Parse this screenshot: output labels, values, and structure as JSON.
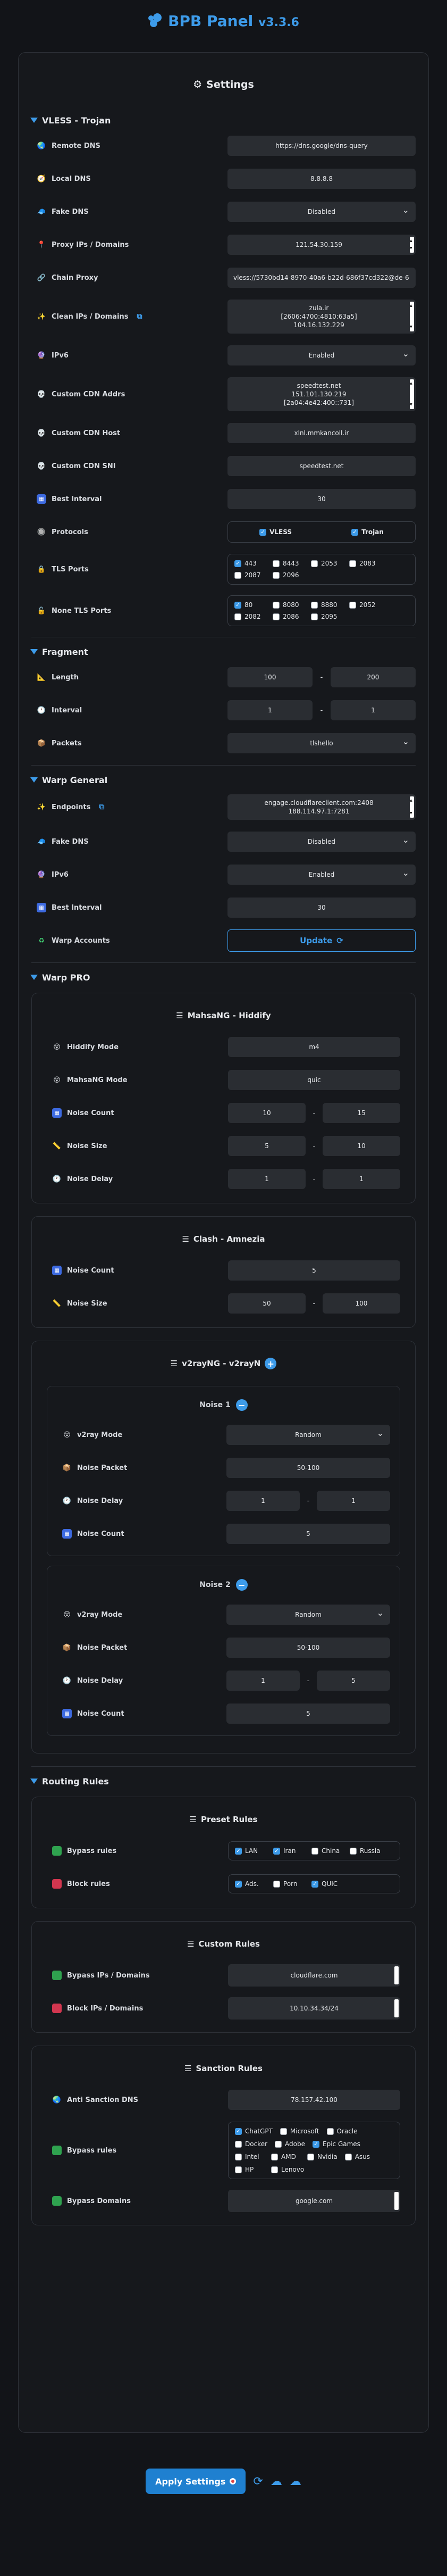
{
  "header": {
    "title": "BPB Panel",
    "version": "v3.3.6"
  },
  "settings": {
    "title": "Settings"
  },
  "vless": {
    "section": "VLESS - Trojan",
    "remote_dns": {
      "label": "Remote DNS",
      "value": "https://dns.google/dns-query"
    },
    "local_dns": {
      "label": "Local DNS",
      "value": "8.8.8.8"
    },
    "fake_dns": {
      "label": "Fake DNS",
      "value": "Disabled"
    },
    "proxy_ips": {
      "label": "Proxy IPs / Domains",
      "value": "121.54.30.159"
    },
    "chain_proxy": {
      "label": "Chain Proxy",
      "value": "vless://5730bd14-8970-40a6-b22d-686f37cd322@de-6"
    },
    "clean_ips": {
      "label": "Clean IPs / Domains",
      "lines": [
        "zula.ir",
        "[2606:4700:4810:63a5]",
        "104.16.132.229"
      ]
    },
    "ipv6": {
      "label": "IPv6",
      "value": "Enabled"
    },
    "cdn_addrs": {
      "label": "Custom CDN Addrs",
      "lines": [
        "speedtest.net",
        "151.101.130.219",
        "[2a04:4e42:400::731]"
      ]
    },
    "cdn_host": {
      "label": "Custom CDN Host",
      "value": "xlnl.mmkancoll.ir"
    },
    "cdn_sni": {
      "label": "Custom CDN SNI",
      "value": "speedtest.net"
    },
    "best_interval": {
      "label": "Best Interval",
      "value": "30"
    },
    "protocols": {
      "label": "Protocols",
      "vless": "VLESS",
      "trojan": "Trojan"
    },
    "tls_ports": {
      "label": "TLS Ports",
      "ports": [
        "443",
        "8443",
        "2053",
        "2083",
        "2087",
        "2096"
      ],
      "checked": [
        true,
        false,
        false,
        false,
        false,
        false
      ]
    },
    "none_tls_ports": {
      "label": "None TLS Ports",
      "ports": [
        "80",
        "8080",
        "8880",
        "2052",
        "2082",
        "2086",
        "2095"
      ],
      "checked": [
        true,
        false,
        false,
        false,
        false,
        false,
        false
      ]
    }
  },
  "fragment": {
    "section": "Fragment",
    "length": {
      "label": "Length",
      "min": "100",
      "max": "200"
    },
    "interval": {
      "label": "Interval",
      "min": "1",
      "max": "1"
    },
    "packets": {
      "label": "Packets",
      "value": "tlshello"
    }
  },
  "warp": {
    "section": "Warp General",
    "endpoints": {
      "label": "Endpoints",
      "lines": [
        "engage.cloudflareclient.com:2408",
        "188.114.97.1:7281"
      ]
    },
    "fake_dns": {
      "label": "Fake DNS",
      "value": "Disabled"
    },
    "ipv6": {
      "label": "IPv6",
      "value": "Enabled"
    },
    "best_interval": {
      "label": "Best Interval",
      "value": "30"
    },
    "accounts": {
      "label": "Warp Accounts",
      "button": "Update"
    }
  },
  "warp_pro": {
    "section": "Warp PRO",
    "hiddify": {
      "title": "MahsaNG - Hiddify",
      "hiddify_mode": {
        "label": "Hiddify Mode",
        "value": "m4"
      },
      "mahsang_mode": {
        "label": "MahsaNG Mode",
        "value": "quic"
      },
      "noise_count": {
        "label": "Noise Count",
        "min": "10",
        "max": "15"
      },
      "noise_size": {
        "label": "Noise Size",
        "min": "5",
        "max": "10"
      },
      "noise_delay": {
        "label": "Noise Delay",
        "min": "1",
        "max": "1"
      }
    },
    "clash": {
      "title": "Clash - Amnezia",
      "noise_count": {
        "label": "Noise Count",
        "value": "5"
      },
      "noise_size": {
        "label": "Noise Size",
        "min": "50",
        "max": "100"
      }
    },
    "v2ray": {
      "title": "v2rayNG - v2rayN",
      "noise1": {
        "title": "Noise 1",
        "mode": {
          "label": "v2ray Mode",
          "value": "Random"
        },
        "packet": {
          "label": "Noise Packet",
          "value": "50-100"
        },
        "delay": {
          "label": "Noise Delay",
          "min": "1",
          "max": "1"
        },
        "count": {
          "label": "Noise Count",
          "value": "5"
        }
      },
      "noise2": {
        "title": "Noise 2",
        "mode": {
          "label": "v2ray Mode",
          "value": "Random"
        },
        "packet": {
          "label": "Noise Packet",
          "value": "50-100"
        },
        "delay": {
          "label": "Noise Delay",
          "min": "1",
          "max": "5"
        },
        "count": {
          "label": "Noise Count",
          "value": "5"
        }
      }
    }
  },
  "routing": {
    "section": "Routing Rules",
    "preset": {
      "title": "Preset Rules",
      "bypass": {
        "label": "Bypass rules",
        "items": [
          "LAN",
          "Iran",
          "China",
          "Russia"
        ],
        "checked": [
          true,
          true,
          false,
          false
        ]
      },
      "block": {
        "label": "Block rules",
        "items": [
          "Ads.",
          "Porn",
          "QUIC"
        ],
        "checked": [
          true,
          false,
          true
        ]
      }
    },
    "custom": {
      "title": "Custom Rules",
      "bypass": {
        "label": "Bypass IPs / Domains",
        "value": "cloudflare.com"
      },
      "block": {
        "label": "Block IPs / Domains",
        "value": "10.10.34.34/24"
      }
    },
    "sanction": {
      "title": "Sanction Rules",
      "anti_dns": {
        "label": "Anti Sanction DNS",
        "value": "78.157.42.100"
      },
      "bypass": {
        "label": "Bypass rules",
        "items": [
          "ChatGPT",
          "Microsoft",
          "Oracle",
          "Docker",
          "Adobe",
          "Epic Games",
          "Intel",
          "AMD",
          "Nvidia",
          "Asus",
          "HP",
          "Lenovo"
        ],
        "checked": [
          true,
          false,
          false,
          false,
          false,
          true,
          false,
          false,
          false,
          false,
          false,
          false
        ]
      },
      "domains": {
        "label": "Bypass Domains",
        "value": "google.com"
      }
    }
  },
  "footer": {
    "apply": "Apply Settings"
  },
  "colors": {
    "accent": "#3d9be9",
    "bg": "#121418",
    "input": "#2a2d32"
  }
}
